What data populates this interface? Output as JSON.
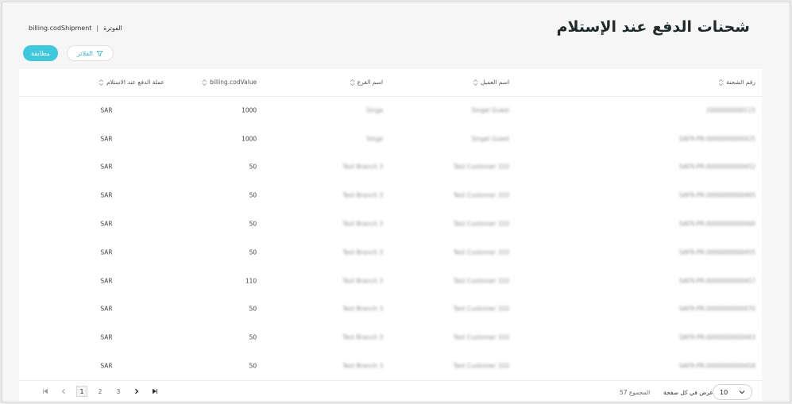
{
  "header": {
    "title": "شحنات الدفع عند الإستلام",
    "breadcrumb": [
      "billing.codShipment",
      "الفوترة"
    ],
    "breadcrumb_sep": "|"
  },
  "toolbar": {
    "match_label": "مطابقة",
    "filter_label": "الفلاتر"
  },
  "table": {
    "columns": [
      "رقم الشحنة",
      "اسم العميل",
      "اسم الفرع",
      "billing.codValue",
      "عملة الدفع عند الاستلام"
    ],
    "rows": [
      [
        "2000000000115",
        "Singel Guest",
        "Singe",
        "1000",
        "SAR"
      ],
      [
        "SAFR-PR-0000000000425",
        "Singel Guest",
        "Singe",
        "1000",
        "SAR"
      ],
      [
        "SAFR-PR-0000000000452",
        "Test Customer 310",
        "Test Branch 3",
        "50",
        "SAR"
      ],
      [
        "SAFR-PR-0000000000465",
        "Test Customer 310",
        "Test Branch 3",
        "50",
        "SAR"
      ],
      [
        "SAFR-PR-0000000000460",
        "Test Customer 310",
        "Test Branch 3",
        "50",
        "SAR"
      ],
      [
        "SAFR-PR-0000000000455",
        "Test Customer 310",
        "Test Branch 3",
        "50",
        "SAR"
      ],
      [
        "SAFR-PR-0000000000457",
        "Test Customer 310",
        "Test Branch 3",
        "110",
        "SAR"
      ],
      [
        "SAFR-PR-0000000000470",
        "Test Customer 310",
        "Test Branch 3",
        "50",
        "SAR"
      ],
      [
        "SAFR-PR-0000000000463",
        "Test Customer 310",
        "Test Branch 3",
        "50",
        "SAR"
      ],
      [
        "SAFR-PR-0000000000458",
        "Test Customer 310",
        "Test Branch 3",
        "50",
        "SAR"
      ]
    ]
  },
  "footer": {
    "pages": [
      "1",
      "2",
      "3"
    ],
    "current_page": "1",
    "total_label": "المجموع 57",
    "per_page_label": "عرض في كل صفحة",
    "per_page_value": "10"
  }
}
